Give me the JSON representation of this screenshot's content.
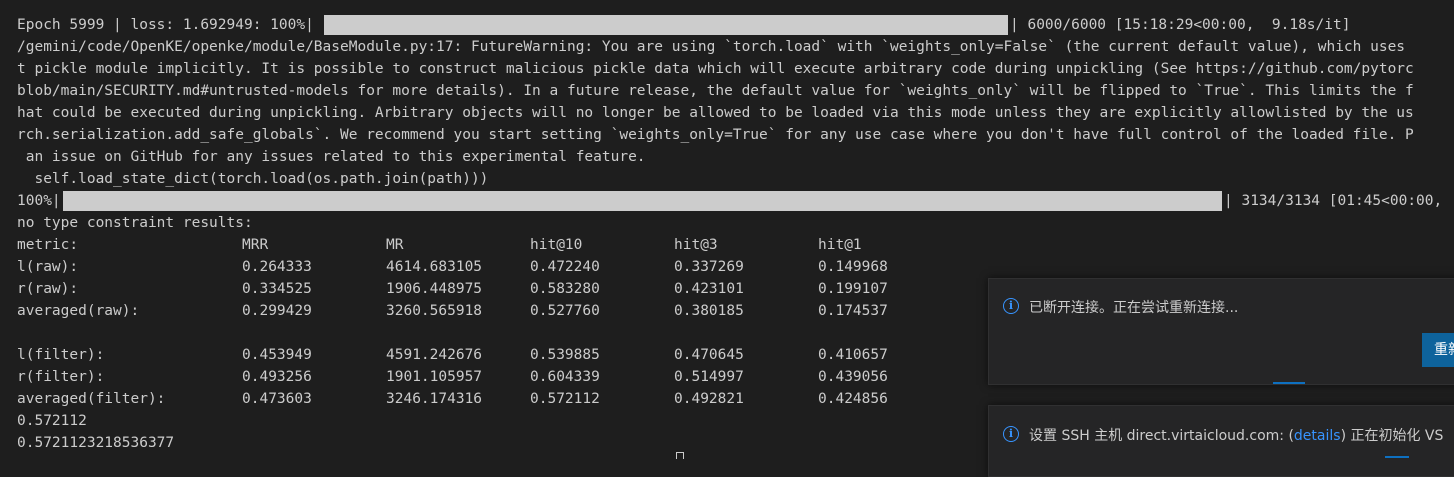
{
  "terminal": {
    "epoch_prefix": "Epoch 5999 | loss: 1.692949: 100%|",
    "epoch_suffix": "| 6000/6000 [15:18:29<00:00,  9.18s/it]",
    "warning_lines": [
      "/gemini/code/OpenKE/openke/module/BaseModule.py:17: FutureWarning: You are using `torch.load` with `weights_only=False` (the current default value), which uses",
      "t pickle module implicitly. It is possible to construct malicious pickle data which will execute arbitrary code during unpickling (See https://github.com/pytorc",
      "blob/main/SECURITY.md#untrusted-models for more details). In a future release, the default value for `weights_only` will be flipped to `True`. This limits the f",
      "hat could be executed during unpickling. Arbitrary objects will no longer be allowed to be loaded via this mode unless they are explicitly allowlisted by the us",
      "rch.serialization.add_safe_globals`. We recommend you start setting `weights_only=True` for any use case where you don't have full control of the loaded file. P",
      " an issue on GitHub for any issues related to this experimental feature.",
      "  self.load_state_dict(torch.load(os.path.join(path)))"
    ],
    "test_prefix": "100%|",
    "test_suffix": "| 3134/3134 [01:45<00:00,",
    "results_header": "no type constraint results:",
    "table": {
      "headers": [
        "metric:",
        "MRR",
        "MR",
        "hit@10",
        "hit@3",
        "hit@1"
      ],
      "rows": [
        [
          "l(raw):",
          "0.264333",
          "4614.683105",
          "0.472240",
          "0.337269",
          "0.149968"
        ],
        [
          "r(raw):",
          "0.334525",
          "1906.448975",
          "0.583280",
          "0.423101",
          "0.199107"
        ],
        [
          "averaged(raw):",
          "0.299429",
          "3260.565918",
          "0.527760",
          "0.380185",
          "0.174537"
        ],
        [
          "",
          "",
          "",
          "",
          "",
          ""
        ],
        [
          "l(filter):",
          "0.453949",
          "4591.242676",
          "0.539885",
          "0.470645",
          "0.410657"
        ],
        [
          "r(filter):",
          "0.493256",
          "1901.105957",
          "0.604339",
          "0.514997",
          "0.439056"
        ],
        [
          "averaged(filter):",
          "0.473603",
          "3246.174316",
          "0.572112",
          "0.492821",
          "0.424856"
        ]
      ]
    },
    "output_lines": [
      "0.572112",
      "0.5721123218536377"
    ],
    "progress_epoch": 1.0,
    "progress_test": 1.0
  },
  "notifications": {
    "disconnected": {
      "icon": "info-icon",
      "message": "已断开连接。正在尝试重新连接...",
      "button_label": "重新"
    },
    "ssh": {
      "icon": "info-icon",
      "prefix": "设置 SSH 主机 direct.virtaicloud.com: (",
      "link": "details",
      "suffix": ") 正在初始化 VS"
    }
  },
  "colors": {
    "background": "#1e1e1e",
    "text": "#cccccc",
    "accent": "#3794ff",
    "button": "#0e639c"
  }
}
